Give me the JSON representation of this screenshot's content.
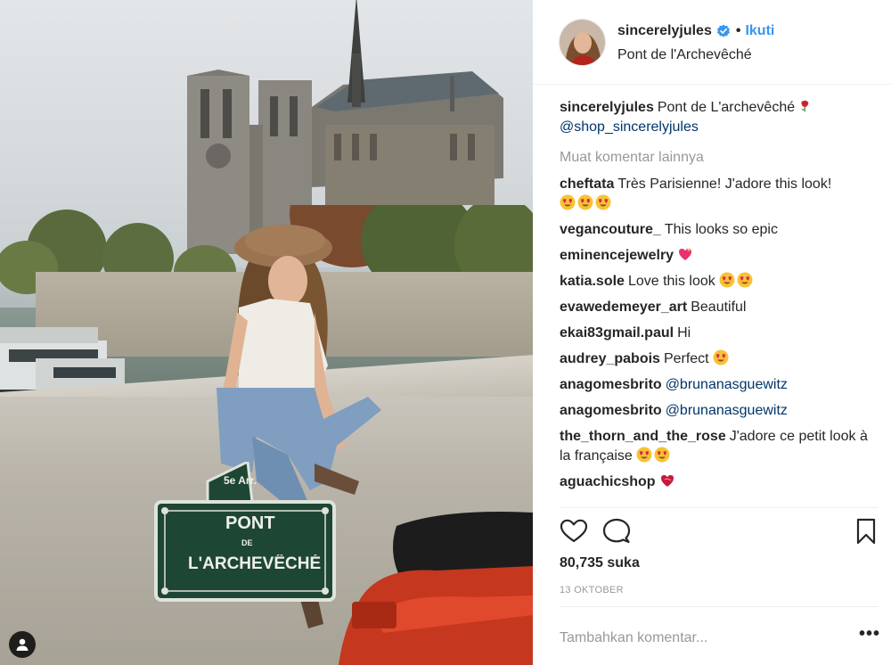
{
  "header": {
    "username": "sincerelyjules",
    "separator": "•",
    "follow_label": "Ikuti",
    "location": "Pont de l'Archevêché",
    "verified_icon": "verified-badge-icon"
  },
  "caption": {
    "username": "sincerelyjules",
    "text": "Pont de L'archevêché",
    "mention": "@shop_sincerelyjules",
    "emoji": "rose-emoji"
  },
  "load_more_label": "Muat komentar lainnya",
  "comments": [
    {
      "user": "cheftata",
      "text": "Très Parisienne! J'adore this look!",
      "emoji_count": 3,
      "emoji": "heart-eyes"
    },
    {
      "user": "vegancouture_",
      "text": "This looks so epic",
      "emoji_count": 0
    },
    {
      "user": "eminencejewelry",
      "text": "",
      "emoji_count": 1,
      "emoji": "sparkling-heart"
    },
    {
      "user": "katia.sole",
      "text": "Love this look",
      "emoji_count": 2,
      "emoji": "heart-eyes"
    },
    {
      "user": "evawedemeyer_art",
      "text": "Beautiful",
      "emoji_count": 0
    },
    {
      "user": "ekai83gmail.paul",
      "text": "Hi",
      "emoji_count": 0
    },
    {
      "user": "audrey_pabois",
      "text": "Perfect",
      "emoji_count": 1,
      "emoji": "heart-eyes"
    },
    {
      "user": "anagomesbrito",
      "text": "",
      "mention": "@brunanasguewitz",
      "emoji_count": 0
    },
    {
      "user": "anagomesbrito",
      "text": "",
      "mention": "@brunanasguewitz",
      "emoji_count": 0
    },
    {
      "user": "the_thorn_and_the_rose",
      "text": "J'adore ce petit look à la française",
      "emoji_count": 2,
      "emoji": "heart-eyes"
    },
    {
      "user": "aguachicshop",
      "text": "",
      "emoji_count": 1,
      "emoji": "heart-exclamation"
    }
  ],
  "likes_label": "80,735 suka",
  "date_label": "13 OKTOBER",
  "add_comment_placeholder": "Tambahkan komentar...",
  "more_options_label": "•••",
  "photo": {
    "sign_line1": "5e Arr.",
    "sign_line2": "PONT",
    "sign_line3": "DE",
    "sign_line4": "L'ARCHEVÊCHÉ"
  },
  "colors": {
    "link_blue": "#3897f0",
    "mention_blue": "#003569",
    "muted_gray": "#999999",
    "text_dark": "#262626"
  }
}
